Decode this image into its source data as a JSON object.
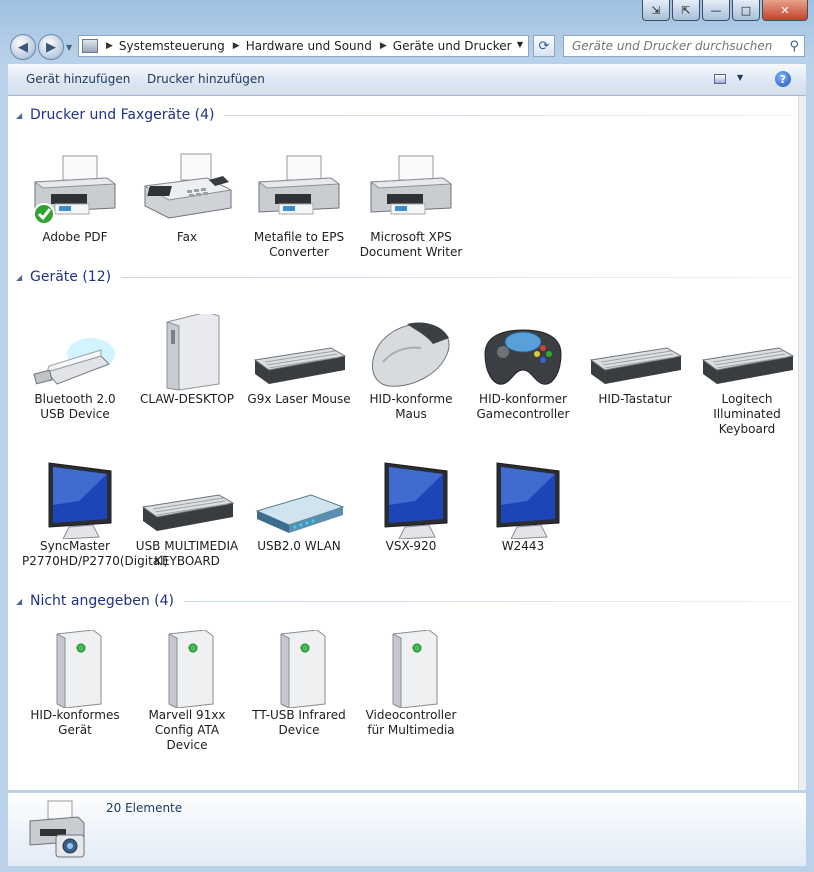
{
  "caption_buttons": {
    "extra1": "⇲",
    "extra2": "⇱",
    "minimize": "—",
    "maximize": "□",
    "close": "✕"
  },
  "navigation": {
    "back_icon": "back-arrow-icon",
    "forward_icon": "forward-arrow-icon",
    "breadcrumbs": [
      "Systemsteuerung",
      "Hardware und Sound",
      "Geräte und Drucker"
    ],
    "search_placeholder": "Geräte und Drucker durchsuchen"
  },
  "toolbar": {
    "add_device": "Gerät hinzufügen",
    "add_printer": "Drucker hinzufügen",
    "help": "?"
  },
  "groups": {
    "printers": {
      "title": "Drucker und Faxgeräte (4)",
      "items": [
        {
          "label": "Adobe PDF",
          "icon": "printer-icon",
          "default": true
        },
        {
          "label": "Fax",
          "icon": "fax-icon"
        },
        {
          "label": "Metafile to EPS Converter",
          "icon": "printer-icon"
        },
        {
          "label": "Microsoft XPS Document Writer",
          "icon": "printer-icon"
        }
      ]
    },
    "devices": {
      "title": "Geräte (12)",
      "items": [
        {
          "label": "Bluetooth 2.0 USB Device",
          "icon": "usb-stick-icon"
        },
        {
          "label": "CLAW-DESKTOP",
          "icon": "computer-tower-icon"
        },
        {
          "label": "G9x Laser Mouse",
          "icon": "keyboard-icon"
        },
        {
          "label": "HID-konforme Maus",
          "icon": "mouse-icon"
        },
        {
          "label": "HID-konformer Gamecontroller",
          "icon": "gamepad-icon"
        },
        {
          "label": "HID-Tastatur",
          "icon": "keyboard-icon"
        },
        {
          "label": "Logitech Illuminated Keyboard",
          "icon": "keyboard-icon"
        },
        {
          "label": "SyncMaster P2770HD/P2770(Digital)",
          "icon": "monitor-icon"
        },
        {
          "label": "USB MULTIMEDIA KEYBOARD",
          "icon": "keyboard-icon"
        },
        {
          "label": "USB2.0 WLAN",
          "icon": "router-icon"
        },
        {
          "label": "VSX-920",
          "icon": "monitor-icon"
        },
        {
          "label": "W2443",
          "icon": "monitor-icon"
        }
      ]
    },
    "unspecified": {
      "title": "Nicht angegeben (4)",
      "items": [
        {
          "label": "HID-konformes Gerät",
          "icon": "generic-device-icon"
        },
        {
          "label": "Marvell 91xx Config ATA Device",
          "icon": "generic-device-icon"
        },
        {
          "label": "TT-USB Infrared Device",
          "icon": "generic-device-icon"
        },
        {
          "label": "Videocontroller für Multimedia",
          "icon": "generic-device-icon"
        }
      ]
    }
  },
  "status": {
    "count": "20 Elemente",
    "icon": "printer-camera-icon"
  },
  "colors": {
    "group_title": "#1e3287",
    "toolbar_text": "#1e395b",
    "window_frame": "#b9d2ea"
  }
}
